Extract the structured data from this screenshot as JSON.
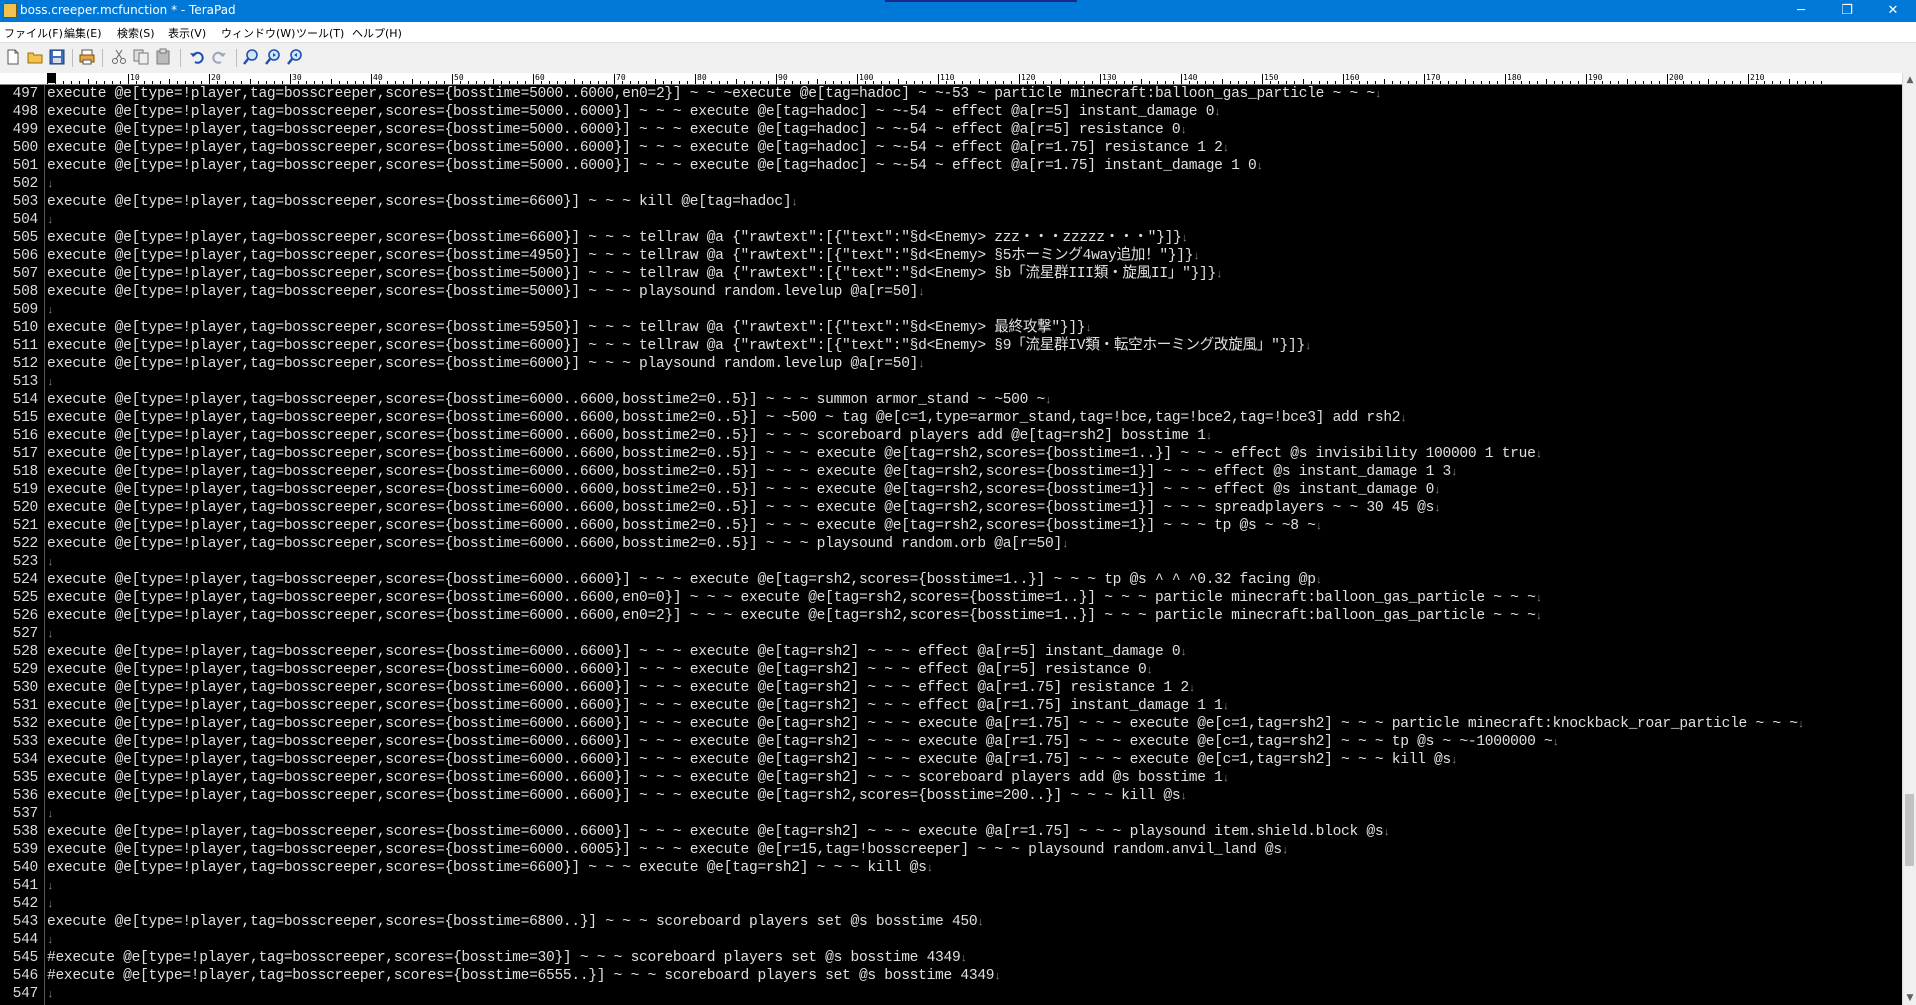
{
  "window": {
    "title": "boss.creeper.mcfunction * - TeraPad",
    "controls": [
      "─",
      "❐",
      "✕"
    ]
  },
  "menu": [
    "ファイル(F)",
    "編集(E)",
    "検索(S)",
    "表示(V)",
    "ウィンドウ(W)",
    "ツール(T)",
    "ヘルプ(H)"
  ],
  "toolbar": {
    "icons": [
      "new-file-icon",
      "open-folder-icon",
      "save-icon",
      "print-icon",
      "cut-icon",
      "copy-icon",
      "paste-icon",
      "undo-icon",
      "redo-icon",
      "find-icon",
      "find-next-icon",
      "find-previous-icon"
    ]
  },
  "ruler": {
    "labels": [
      "0",
      "10",
      "20",
      "30",
      "40",
      "50",
      "60",
      "70",
      "80",
      "90",
      "100",
      "110",
      "120",
      "130",
      "140",
      "150",
      "160",
      "170",
      "180",
      "190",
      "200",
      "210"
    ]
  },
  "colors": {
    "titlebar": "#0078d7",
    "editor_background": "#000000",
    "text": "#e0e0e0",
    "eol_marker": "#8a8a8a"
  },
  "editor": {
    "lines": [
      {
        "n": "497",
        "text": "execute @e[type=!player,tag=bosscreeper,scores={bosstime=5000..6000,en0=2}] ~ ~ ~execute @e[tag=hadoc] ~ ~-53 ~ particle minecraft:balloon_gas_particle ~ ~ ~"
      },
      {
        "n": "498",
        "text": "execute @e[type=!player,tag=bosscreeper,scores={bosstime=5000..6000}] ~ ~ ~ execute @e[tag=hadoc] ~ ~-54 ~ effect @a[r=5] instant_damage 0"
      },
      {
        "n": "499",
        "text": "execute @e[type=!player,tag=bosscreeper,scores={bosstime=5000..6000}] ~ ~ ~ execute @e[tag=hadoc] ~ ~-54 ~ effect @a[r=5] resistance 0"
      },
      {
        "n": "500",
        "text": "execute @e[type=!player,tag=bosscreeper,scores={bosstime=5000..6000}] ~ ~ ~ execute @e[tag=hadoc] ~ ~-54 ~ effect @a[r=1.75] resistance 1 2"
      },
      {
        "n": "501",
        "text": "execute @e[type=!player,tag=bosscreeper,scores={bosstime=5000..6000}] ~ ~ ~ execute @e[tag=hadoc] ~ ~-54 ~ effect @a[r=1.75] instant_damage 1 0"
      },
      {
        "n": "502",
        "text": ""
      },
      {
        "n": "503",
        "text": "execute @e[type=!player,tag=bosscreeper,scores={bosstime=6600}] ~ ~ ~ kill @e[tag=hadoc]"
      },
      {
        "n": "504",
        "text": ""
      },
      {
        "n": "505",
        "text": "execute @e[type=!player,tag=bosscreeper,scores={bosstime=6600}] ~ ~ ~ tellraw @a {\"rawtext\":[{\"text\":\"§d<Enemy> zzz・・・zzzzz・・・\"}]}"
      },
      {
        "n": "506",
        "text": "execute @e[type=!player,tag=bosscreeper,scores={bosstime=4950}] ~ ~ ~ tellraw @a {\"rawtext\":[{\"text\":\"§d<Enemy> §5ホーミング4way追加！\"}]}"
      },
      {
        "n": "507",
        "text": "execute @e[type=!player,tag=bosscreeper,scores={bosstime=5000}] ~ ~ ~ tellraw @a {\"rawtext\":[{\"text\":\"§d<Enemy> §b「流星群III類・旋風II」\"}]}"
      },
      {
        "n": "508",
        "text": "execute @e[type=!player,tag=bosscreeper,scores={bosstime=5000}] ~ ~ ~ playsound random.levelup @a[r=50]"
      },
      {
        "n": "509",
        "text": ""
      },
      {
        "n": "510",
        "text": "execute @e[type=!player,tag=bosscreeper,scores={bosstime=5950}] ~ ~ ~ tellraw @a {\"rawtext\":[{\"text\":\"§d<Enemy> 最終攻撃\"}]}"
      },
      {
        "n": "511",
        "text": "execute @e[type=!player,tag=bosscreeper,scores={bosstime=6000}] ~ ~ ~ tellraw @a {\"rawtext\":[{\"text\":\"§d<Enemy> §9「流星群IV類・転空ホーミング改旋風」\"}]}"
      },
      {
        "n": "512",
        "text": "execute @e[type=!player,tag=bosscreeper,scores={bosstime=6000}] ~ ~ ~ playsound random.levelup @a[r=50]"
      },
      {
        "n": "513",
        "text": ""
      },
      {
        "n": "514",
        "text": "execute @e[type=!player,tag=bosscreeper,scores={bosstime=6000..6600,bosstime2=0..5}] ~ ~ ~ summon armor_stand ~ ~500 ~"
      },
      {
        "n": "515",
        "text": "execute @e[type=!player,tag=bosscreeper,scores={bosstime=6000..6600,bosstime2=0..5}] ~ ~500 ~ tag @e[c=1,type=armor_stand,tag=!bce,tag=!bce2,tag=!bce3] add rsh2"
      },
      {
        "n": "516",
        "text": "execute @e[type=!player,tag=bosscreeper,scores={bosstime=6000..6600,bosstime2=0..5}] ~ ~ ~ scoreboard players add @e[tag=rsh2] bosstime 1"
      },
      {
        "n": "517",
        "text": "execute @e[type=!player,tag=bosscreeper,scores={bosstime=6000..6600,bosstime2=0..5}] ~ ~ ~ execute @e[tag=rsh2,scores={bosstime=1..}] ~ ~ ~ effect @s invisibility 100000 1 true"
      },
      {
        "n": "518",
        "text": "execute @e[type=!player,tag=bosscreeper,scores={bosstime=6000..6600,bosstime2=0..5}] ~ ~ ~ execute @e[tag=rsh2,scores={bosstime=1}] ~ ~ ~ effect @s instant_damage 1 3"
      },
      {
        "n": "519",
        "text": "execute @e[type=!player,tag=bosscreeper,scores={bosstime=6000..6600,bosstime2=0..5}] ~ ~ ~ execute @e[tag=rsh2,scores={bosstime=1}] ~ ~ ~ effect @s instant_damage 0"
      },
      {
        "n": "520",
        "text": "execute @e[type=!player,tag=bosscreeper,scores={bosstime=6000..6600,bosstime2=0..5}] ~ ~ ~ execute @e[tag=rsh2,scores={bosstime=1}] ~ ~ ~ spreadplayers ~ ~ 30 45 @s"
      },
      {
        "n": "521",
        "text": "execute @e[type=!player,tag=bosscreeper,scores={bosstime=6000..6600,bosstime2=0..5}] ~ ~ ~ execute @e[tag=rsh2,scores={bosstime=1}] ~ ~ ~ tp @s ~ ~8 ~"
      },
      {
        "n": "522",
        "text": "execute @e[type=!player,tag=bosscreeper,scores={bosstime=6000..6600,bosstime2=0..5}] ~ ~ ~ playsound random.orb @a[r=50]"
      },
      {
        "n": "523",
        "text": ""
      },
      {
        "n": "524",
        "text": "execute @e[type=!player,tag=bosscreeper,scores={bosstime=6000..6600}] ~ ~ ~ execute @e[tag=rsh2,scores={bosstime=1..}] ~ ~ ~ tp @s ^ ^ ^0.32 facing @p"
      },
      {
        "n": "525",
        "text": "execute @e[type=!player,tag=bosscreeper,scores={bosstime=6000..6600,en0=0}] ~ ~ ~ execute @e[tag=rsh2,scores={bosstime=1..}] ~ ~ ~ particle minecraft:balloon_gas_particle ~ ~ ~"
      },
      {
        "n": "526",
        "text": "execute @e[type=!player,tag=bosscreeper,scores={bosstime=6000..6600,en0=2}] ~ ~ ~ execute @e[tag=rsh2,scores={bosstime=1..}] ~ ~ ~ particle minecraft:balloon_gas_particle ~ ~ ~"
      },
      {
        "n": "527",
        "text": ""
      },
      {
        "n": "528",
        "text": "execute @e[type=!player,tag=bosscreeper,scores={bosstime=6000..6600}] ~ ~ ~ execute @e[tag=rsh2] ~ ~ ~ effect @a[r=5] instant_damage 0"
      },
      {
        "n": "529",
        "text": "execute @e[type=!player,tag=bosscreeper,scores={bosstime=6000..6600}] ~ ~ ~ execute @e[tag=rsh2] ~ ~ ~ effect @a[r=5] resistance 0"
      },
      {
        "n": "530",
        "text": "execute @e[type=!player,tag=bosscreeper,scores={bosstime=6000..6600}] ~ ~ ~ execute @e[tag=rsh2] ~ ~ ~ effect @a[r=1.75] resistance 1 2"
      },
      {
        "n": "531",
        "text": "execute @e[type=!player,tag=bosscreeper,scores={bosstime=6000..6600}] ~ ~ ~ execute @e[tag=rsh2] ~ ~ ~ effect @a[r=1.75] instant_damage 1 1"
      },
      {
        "n": "532",
        "text": "execute @e[type=!player,tag=bosscreeper,scores={bosstime=6000..6600}] ~ ~ ~ execute @e[tag=rsh2] ~ ~ ~ execute @a[r=1.75] ~ ~ ~ execute @e[c=1,tag=rsh2] ~ ~ ~ particle minecraft:knockback_roar_particle ~ ~ ~"
      },
      {
        "n": "533",
        "text": "execute @e[type=!player,tag=bosscreeper,scores={bosstime=6000..6600}] ~ ~ ~ execute @e[tag=rsh2] ~ ~ ~ execute @a[r=1.75] ~ ~ ~ execute @e[c=1,tag=rsh2] ~ ~ ~ tp @s ~ ~-1000000 ~"
      },
      {
        "n": "534",
        "text": "execute @e[type=!player,tag=bosscreeper,scores={bosstime=6000..6600}] ~ ~ ~ execute @e[tag=rsh2] ~ ~ ~ execute @a[r=1.75] ~ ~ ~ execute @e[c=1,tag=rsh2] ~ ~ ~ kill @s"
      },
      {
        "n": "535",
        "text": "execute @e[type=!player,tag=bosscreeper,scores={bosstime=6000..6600}] ~ ~ ~ execute @e[tag=rsh2] ~ ~ ~ scoreboard players add @s bosstime 1"
      },
      {
        "n": "536",
        "text": "execute @e[type=!player,tag=bosscreeper,scores={bosstime=6000..6600}] ~ ~ ~ execute @e[tag=rsh2,scores={bosstime=200..}] ~ ~ ~ kill @s"
      },
      {
        "n": "537",
        "text": ""
      },
      {
        "n": "538",
        "text": "execute @e[type=!player,tag=bosscreeper,scores={bosstime=6000..6600}] ~ ~ ~ execute @e[tag=rsh2] ~ ~ ~ execute @a[r=1.75] ~ ~ ~ playsound item.shield.block @s"
      },
      {
        "n": "539",
        "text": "execute @e[type=!player,tag=bosscreeper,scores={bosstime=6000..6005}] ~ ~ ~ execute @e[r=15,tag=!bosscreeper] ~ ~ ~ playsound random.anvil_land @s"
      },
      {
        "n": "540",
        "text": "execute @e[type=!player,tag=bosscreeper,scores={bosstime=6600}] ~ ~ ~ execute @e[tag=rsh2] ~ ~ ~ kill @s"
      },
      {
        "n": "541",
        "text": ""
      },
      {
        "n": "542",
        "text": ""
      },
      {
        "n": "543",
        "text": "execute @e[type=!player,tag=bosscreeper,scores={bosstime=6800..}] ~ ~ ~ scoreboard players set @s bosstime 450"
      },
      {
        "n": "544",
        "text": ""
      },
      {
        "n": "545",
        "text": "#execute @e[type=!player,tag=bosscreeper,scores={bosstime=30}] ~ ~ ~ scoreboard players set @s bosstime 4349"
      },
      {
        "n": "546",
        "text": "#execute @e[type=!player,tag=bosscreeper,scores={bosstime=6555..}] ~ ~ ~ scoreboard players set @s bosstime 4349"
      },
      {
        "n": "547",
        "text": ""
      }
    ]
  }
}
